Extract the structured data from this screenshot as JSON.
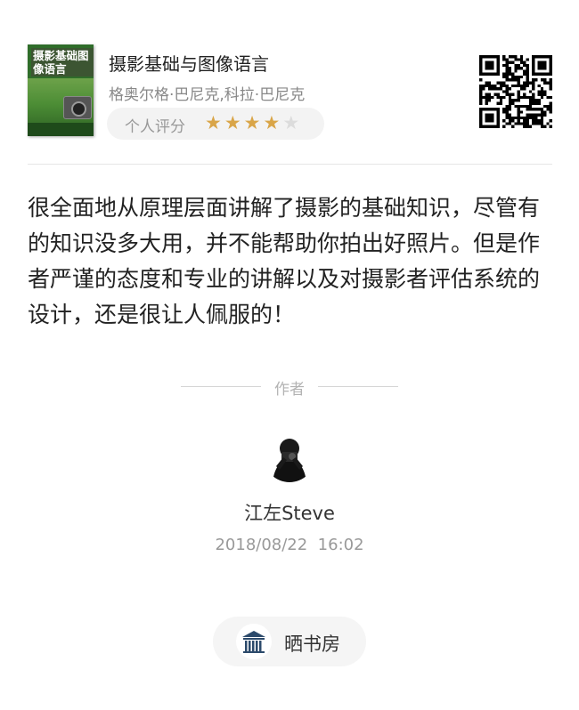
{
  "book": {
    "cover_title": "摄影基础图像语言",
    "title": "摄影基础与图像语言",
    "author": "格奥尔格·巴尼克,科拉·巴尼克",
    "rating_label": "个人评分",
    "rating": 4,
    "rating_max": 5
  },
  "review": {
    "text": "很全面地从原理层面讲解了摄影的基础知识，尽管有的知识没多大用，并不能帮助你拍出好照片。但是作者严谨的态度和专业的讲解以及对摄影者评估系统的设计，还是很让人佩服的！"
  },
  "author_section": {
    "label": "作者",
    "name": "江左Steve",
    "datetime": "2018/08/22  16:02"
  },
  "app": {
    "name": "晒书房"
  },
  "colors": {
    "star_filled": "#d9a548",
    "star_empty": "#dcdcdc",
    "text": "#222222",
    "muted": "#999999"
  },
  "icons": {
    "qr": "qr-code-icon",
    "avatar": "user-avatar",
    "app": "bookshelf-icon"
  }
}
